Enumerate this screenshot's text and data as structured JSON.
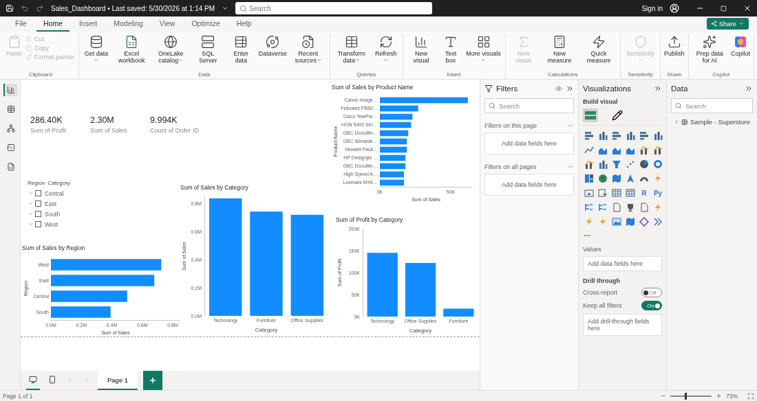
{
  "title_bar": {
    "title": "Sales_Dashboard • Last saved: 5/30/2026 at 1:14 PM",
    "search": {
      "placeholder": "Search"
    },
    "sign_in": "Sign in"
  },
  "menu_tabs": [
    {
      "label": "File",
      "selected": false
    },
    {
      "label": "Home",
      "selected": true
    },
    {
      "label": "Insert",
      "selected": false
    },
    {
      "label": "Modeling",
      "selected": false
    },
    {
      "label": "View",
      "selected": false
    },
    {
      "label": "Optimize",
      "selected": false
    },
    {
      "label": "Help",
      "selected": false
    }
  ],
  "share_button": "Share",
  "ribbon": [
    {
      "group": "Clipboard",
      "buttons": [
        {
          "label": "Paste",
          "kind": "large",
          "disabled": true,
          "dropdown": false
        },
        {
          "label": "Cut",
          "kind": "small",
          "disabled": true,
          "dropdown": false
        },
        {
          "label": "Copy",
          "kind": "small",
          "disabled": true,
          "dropdown": false
        },
        {
          "label": "Format painter",
          "kind": "small",
          "disabled": true,
          "dropdown": false
        }
      ]
    },
    {
      "group": "Data",
      "buttons": [
        {
          "label": "Get data",
          "kind": "large",
          "disabled": false,
          "dropdown": true
        },
        {
          "label": "Excel workbook",
          "kind": "large",
          "disabled": false,
          "dropdown": false
        },
        {
          "label": "OneLake catalog",
          "kind": "large",
          "disabled": false,
          "dropdown": true
        },
        {
          "label": "SQL Server",
          "kind": "large",
          "disabled": false,
          "dropdown": false
        },
        {
          "label": "Enter data",
          "kind": "large",
          "disabled": false,
          "dropdown": false
        },
        {
          "label": "Dataverse",
          "kind": "large",
          "disabled": false,
          "dropdown": false
        },
        {
          "label": "Recent sources",
          "kind": "large",
          "disabled": false,
          "dropdown": true
        }
      ]
    },
    {
      "group": "Queries",
      "buttons": [
        {
          "label": "Transform data",
          "kind": "large",
          "disabled": false,
          "dropdown": true
        },
        {
          "label": "Refresh",
          "kind": "large",
          "disabled": false,
          "dropdown": true
        }
      ]
    },
    {
      "group": "Insert",
      "buttons": [
        {
          "label": "New visual",
          "kind": "large",
          "disabled": false,
          "dropdown": false
        },
        {
          "label": "Text box",
          "kind": "large",
          "disabled": false,
          "dropdown": false
        },
        {
          "label": "More visuals",
          "kind": "large",
          "disabled": false,
          "dropdown": true
        }
      ]
    },
    {
      "group": "Calculations",
      "buttons": [
        {
          "label": "New visual",
          "kind": "large",
          "disabled": true,
          "dropdown": false
        },
        {
          "label": "New measure",
          "kind": "large",
          "disabled": false,
          "dropdown": false
        },
        {
          "label": "Quick measure",
          "kind": "large",
          "disabled": false,
          "dropdown": false
        }
      ]
    },
    {
      "group": "Sensitivity",
      "buttons": [
        {
          "label": "Sensitivity",
          "kind": "large",
          "disabled": true,
          "dropdown": true
        }
      ]
    },
    {
      "group": "Share",
      "buttons": [
        {
          "label": "Publish",
          "kind": "large",
          "disabled": false,
          "dropdown": false
        }
      ]
    },
    {
      "group": "Copilot",
      "buttons": [
        {
          "label": "Prep data for AI",
          "kind": "large",
          "disabled": false,
          "dropdown": false
        },
        {
          "label": "Copilot",
          "kind": "large",
          "disabled": false,
          "dropdown": false
        }
      ]
    }
  ],
  "rail": [
    {
      "selected": true
    },
    {
      "selected": false
    },
    {
      "selected": false
    },
    {
      "selected": false
    },
    {
      "selected": false
    }
  ],
  "canvas": {
    "cards": [
      {
        "value": "286.40K",
        "label": "Sum of Profit"
      },
      {
        "value": "2.30M",
        "label": "Sum of Sales"
      },
      {
        "value": "9.994K",
        "label": "Count of Order ID"
      }
    ],
    "slicer": {
      "headers": [
        "Region",
        "Category"
      ],
      "items": [
        {
          "label": "Central",
          "checked": false
        },
        {
          "label": "East",
          "checked": false
        },
        {
          "label": "South",
          "checked": false
        },
        {
          "label": "West",
          "checked": false
        }
      ]
    },
    "charts": [
      {
        "chart_data": {
          "type": "bar",
          "orientation": "horizontal",
          "title": "Sum of Sales by Product Name",
          "xlabel": "Sum of Sales",
          "ylabel": "Product Name",
          "categories": [
            "Canon image…",
            "Fellowes PB50…",
            "Cisco TelePre…",
            "HON 5400 Ser…",
            "GBC DocuBin…",
            "GBC Ibimaste…",
            "Hewlett Pack…",
            "HP Designjet …",
            "GBC DocuBin…",
            "High Speed A…",
            "Lexmark MX6…"
          ],
          "series": [
            {
              "color": "#118dff",
              "values": [
                62000,
                27000,
                23000,
                22000,
                20000,
                19000,
                19000,
                18000,
                18000,
                17000,
                17000
              ]
            }
          ],
          "xlim": [
            0,
            65000
          ],
          "xticks": [
            {
              "value": 0,
              "label": "0K"
            },
            {
              "value": 50000,
              "label": "50K"
            }
          ]
        }
      },
      {
        "chart_data": {
          "type": "bar",
          "orientation": "vertical",
          "title": "Sum of Sales by Category",
          "xlabel": "Category",
          "ylabel": "Sum of Sales",
          "categories": [
            "Technology",
            "Furniture",
            "Office Supplies"
          ],
          "series": [
            {
              "color": "#118dff",
              "values": [
                836000,
                742000,
                719000
              ]
            }
          ],
          "ylim": [
            0,
            850000
          ],
          "yticks": [
            {
              "value": 0,
              "label": "0.0M"
            },
            {
              "value": 200000,
              "label": "0.2M"
            },
            {
              "value": 400000,
              "label": "0.4M"
            },
            {
              "value": 600000,
              "label": "0.6M"
            },
            {
              "value": 800000,
              "label": "0.8M"
            }
          ]
        }
      },
      {
        "chart_data": {
          "type": "bar",
          "orientation": "vertical",
          "title": "Sum of Profit by Category",
          "xlabel": "Category",
          "ylabel": "Sum of Profit",
          "categories": [
            "Technology",
            "Office Supplies",
            "Furniture"
          ],
          "series": [
            {
              "color": "#118dff",
              "values": [
                145000,
                122000,
                18000
              ]
            }
          ],
          "ylim": [
            0,
            200000
          ],
          "yticks": [
            {
              "value": 0,
              "label": "0K"
            },
            {
              "value": 50000,
              "label": "50K"
            },
            {
              "value": 100000,
              "label": "100K"
            },
            {
              "value": 150000,
              "label": "150K"
            },
            {
              "value": 200000,
              "label": "200K"
            }
          ]
        }
      },
      {
        "chart_data": {
          "type": "bar",
          "orientation": "horizontal",
          "title": "Sum of Sales by Region",
          "xlabel": "Sum of Sales",
          "ylabel": "Region",
          "categories": [
            "West",
            "East",
            "Central",
            "South"
          ],
          "series": [
            {
              "color": "#118dff",
              "values": [
                725000,
                679000,
                501000,
                392000
              ]
            }
          ],
          "xlim": [
            0,
            850000
          ],
          "xticks": [
            {
              "value": 0,
              "label": "0.0M"
            },
            {
              "value": 200000,
              "label": "0.2M"
            },
            {
              "value": 400000,
              "label": "0.4M"
            },
            {
              "value": 600000,
              "label": "0.6M"
            },
            {
              "value": 800000,
              "label": "0.8M"
            }
          ]
        }
      }
    ]
  },
  "filters": {
    "title": "Filters",
    "search": {
      "placeholder": "Search"
    },
    "sections": [
      {
        "title": "Filters on this page",
        "well": "Add data fields here"
      },
      {
        "title": "Filters on all pages",
        "well": "Add data fields here"
      }
    ]
  },
  "visualizations": {
    "title": "Visualizations",
    "subtitle": "Build visual",
    "modes": [
      {
        "selected": true
      },
      {
        "selected": false
      }
    ],
    "types": [
      {
        "kind": "hbars"
      },
      {
        "kind": "vbars"
      },
      {
        "kind": "hbars"
      },
      {
        "kind": "vbars"
      },
      {
        "kind": "hbars"
      },
      {
        "kind": "vbars"
      },
      {
        "kind": "line"
      },
      {
        "kind": "area"
      },
      {
        "kind": "area"
      },
      {
        "kind": "area"
      },
      {
        "kind": "combo"
      },
      {
        "kind": "combo"
      },
      {
        "kind": "combo"
      },
      {
        "kind": "vbars"
      },
      {
        "kind": "funnel"
      },
      {
        "kind": "scatter"
      },
      {
        "kind": "pie"
      },
      {
        "kind": "donut"
      },
      {
        "kind": "treemap"
      },
      {
        "kind": "globe"
      },
      {
        "kind": "map"
      },
      {
        "kind": "arrow"
      },
      {
        "kind": "gauge"
      },
      {
        "kind": "lightning"
      },
      {
        "kind": "card"
      },
      {
        "kind": "slicer"
      },
      {
        "kind": "table"
      },
      {
        "kind": "table"
      },
      {
        "kind": "letters",
        "text": "R"
      },
      {
        "kind": "letters",
        "text": "Py"
      },
      {
        "kind": "tree"
      },
      {
        "kind": "tree"
      },
      {
        "kind": "document"
      },
      {
        "kind": "trophy"
      },
      {
        "kind": "document"
      },
      {
        "kind": "lightning"
      },
      {
        "kind": "lightning"
      },
      {
        "kind": "lightning"
      },
      {
        "kind": "image"
      },
      {
        "kind": "map"
      },
      {
        "kind": "diamond"
      },
      {
        "kind": "chevrons"
      }
    ],
    "values_label": "Values",
    "values_well": "Add data fields here",
    "drill_title": "Drill through",
    "toggles": [
      {
        "label": "Cross-report",
        "on": false,
        "state": "Off"
      },
      {
        "label": "Keep all filters",
        "on": true,
        "state": "On"
      }
    ],
    "drill_well": "Add drill-through fields here"
  },
  "data_pane": {
    "title": "Data",
    "search": {
      "placeholder": "Search"
    },
    "tables": [
      {
        "name": "Sample - Superstore",
        "expanded": false
      }
    ]
  },
  "pages": {
    "views": [
      {
        "selected": true
      },
      {
        "selected": false
      }
    ],
    "tabs": [
      {
        "label": "Page 1",
        "selected": true
      }
    ]
  },
  "status_bar": {
    "page_info": "Page 1 of 1",
    "zoom": {
      "level": 0.35,
      "reading": "73%"
    }
  }
}
